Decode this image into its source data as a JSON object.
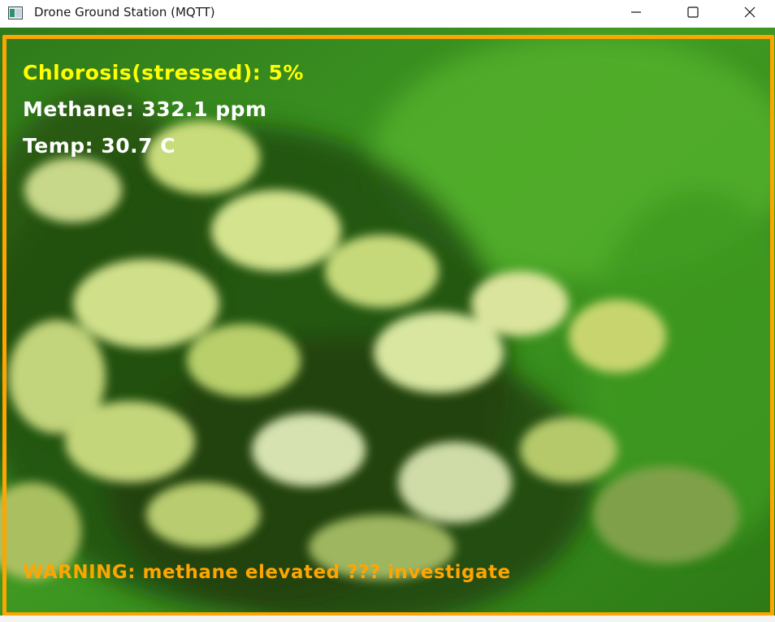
{
  "window": {
    "title": "Drone Ground Station (MQTT)",
    "controls": [
      "minimize",
      "maximize",
      "close"
    ]
  },
  "overlay": {
    "chlorosis": "Chlorosis(stressed): 5%",
    "methane": "Methane: 332.1 ppm",
    "temp": "Temp: 30.7 C",
    "warning": "WARNING: methane elevated ??? investigate"
  },
  "colors": {
    "border": "#ffa500",
    "chlorosis_text": "#ffff00",
    "reading_text": "#ffffff",
    "warning_text": "#ffa500"
  },
  "icons": {
    "app": "app-window-icon",
    "minimize": "minimize-icon",
    "maximize": "maximize-icon",
    "close": "close-icon"
  }
}
